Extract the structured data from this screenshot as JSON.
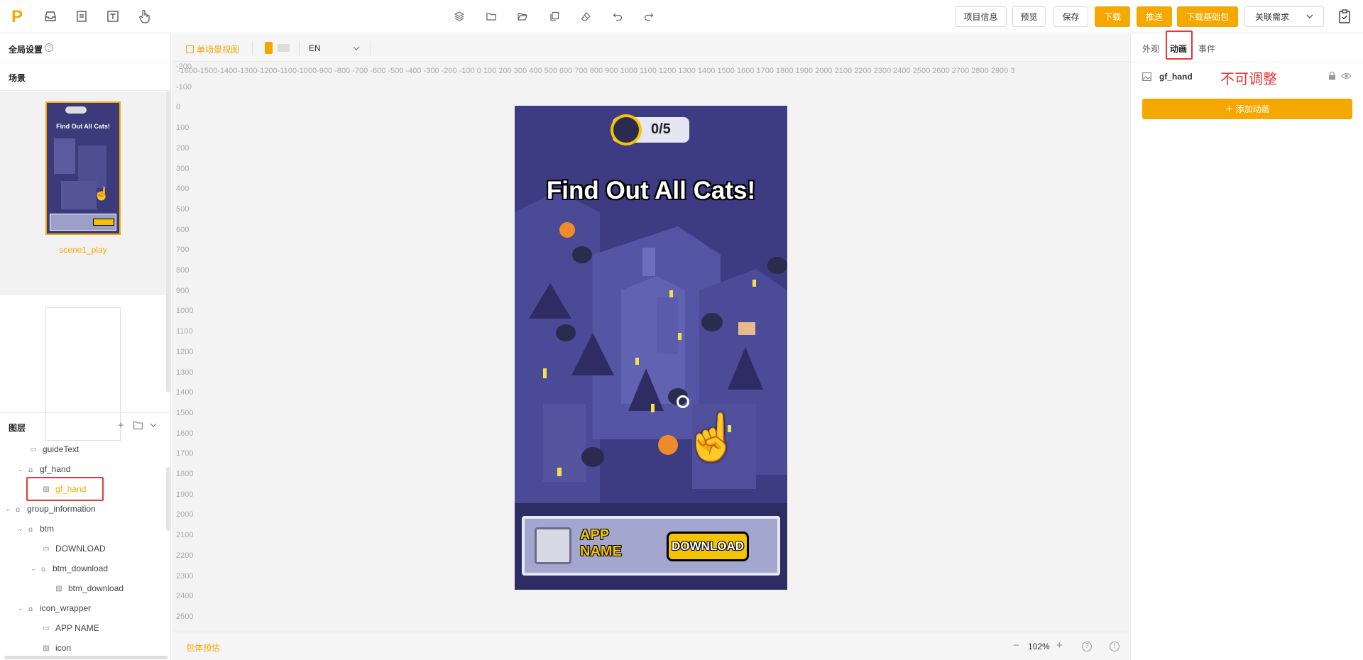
{
  "topbar": {
    "logo": "P",
    "left_icons": [
      "inbox-icon",
      "document-icon",
      "text-icon",
      "pointer-icon"
    ],
    "center_icons": [
      "layers-icon",
      "folder-icon",
      "folder-open-icon",
      "copy-icon",
      "eraser-icon",
      "undo-icon",
      "redo-icon"
    ],
    "buttons": {
      "project_info": "项目信息",
      "preview": "预览",
      "save": "保存",
      "download": "下载",
      "push": "推送",
      "download_base": "下载基础包",
      "related": "关联需求"
    }
  },
  "left": {
    "global_settings": "全局设置",
    "scenes_title": "场景",
    "scene1_name": "scene1_play",
    "scene1_thumb_text": "Find Out All Cats!",
    "layers_title": "图层",
    "layers": [
      {
        "label": "guideText"
      },
      {
        "label": "gf_hand"
      },
      {
        "label": "gf_hand"
      },
      {
        "label": "group_information"
      },
      {
        "label": "btm"
      },
      {
        "label": "DOWNLOAD"
      },
      {
        "label": "btm_download"
      },
      {
        "label": "btm_download"
      },
      {
        "label": "icon_wrapper"
      },
      {
        "label": "APP NAME"
      },
      {
        "label": "icon"
      }
    ]
  },
  "center": {
    "single_view": "单场景视图",
    "language": "EN",
    "ruler_h": "-1600-1500-1400-1300-1200-1100-1000-900  -800  -700  -600  -500  -400  -300  -200  -100  0          100  200  300  400  500  600  700  800  900  1000 1100 1200 1300 1400 1500 1600 1700 1800 1900 2000 2100 2200 2300 2400 2500 2600 2700 2800 2900 3",
    "ruler_v": [
      "-200",
      "-100",
      "0",
      "100",
      "200",
      "300",
      "400",
      "500",
      "600",
      "700",
      "800",
      "900",
      "1000",
      "1100",
      "1200",
      "1300",
      "1400",
      "1500",
      "1600",
      "1700",
      "1800",
      "1900",
      "2000",
      "2100",
      "2200",
      "2300",
      "2400",
      "2500"
    ],
    "game": {
      "counter": "0/5",
      "title": "Find Out All Cats!",
      "app_name_1": "APP",
      "app_name_2": "NAME",
      "download": "DOWNLOAD"
    },
    "bundle_estimate": "包体预估",
    "zoom": "102%"
  },
  "right": {
    "tabs": {
      "appearance": "外观",
      "animation": "动画",
      "event": "事件"
    },
    "item_name": "gf_hand",
    "annotation": "不可调整",
    "add_animation": "＋ 添加动画"
  },
  "colors": {
    "accent": "#f5a800",
    "highlight": "#e53935"
  }
}
